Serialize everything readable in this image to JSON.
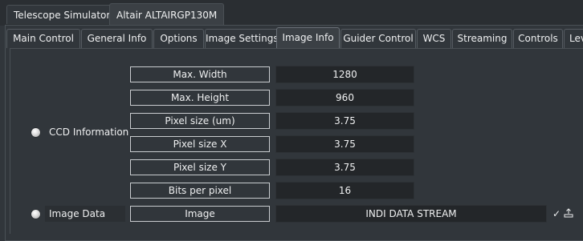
{
  "device_tabs": [
    {
      "label": "Telescope Simulator",
      "active": false
    },
    {
      "label": "Altair ALTAIRGP130M",
      "active": true
    }
  ],
  "property_tabs": [
    {
      "label": "Main Control",
      "active": false
    },
    {
      "label": "General Info",
      "active": false
    },
    {
      "label": "Options",
      "active": false
    },
    {
      "label": "Image Settings",
      "active": false
    },
    {
      "label": "Image Info",
      "active": true
    },
    {
      "label": "Guider Control",
      "active": false
    },
    {
      "label": "WCS",
      "active": false
    },
    {
      "label": "Streaming",
      "active": false
    },
    {
      "label": "Controls",
      "active": false
    },
    {
      "label": "Lev",
      "active": false
    }
  ],
  "ccd_information": {
    "group_label": "CCD Information",
    "state": "idle",
    "rows": [
      {
        "label": "Max. Width",
        "value": "1280"
      },
      {
        "label": "Max. Height",
        "value": "960"
      },
      {
        "label": "Pixel size (um)",
        "value": "3.75"
      },
      {
        "label": "Pixel size X",
        "value": "3.75"
      },
      {
        "label": "Pixel size Y",
        "value": "3.75"
      },
      {
        "label": "Bits per pixel",
        "value": "16"
      }
    ]
  },
  "image_data": {
    "group_label": "Image Data",
    "state": "idle",
    "row": {
      "label": "Image",
      "value": "INDI DATA STREAM"
    },
    "enabled_check": "✓",
    "upload_icon": "upload-icon"
  },
  "colors": {
    "background": "#31363b",
    "field": "#232629",
    "led_idle": "#dcdcdc"
  }
}
